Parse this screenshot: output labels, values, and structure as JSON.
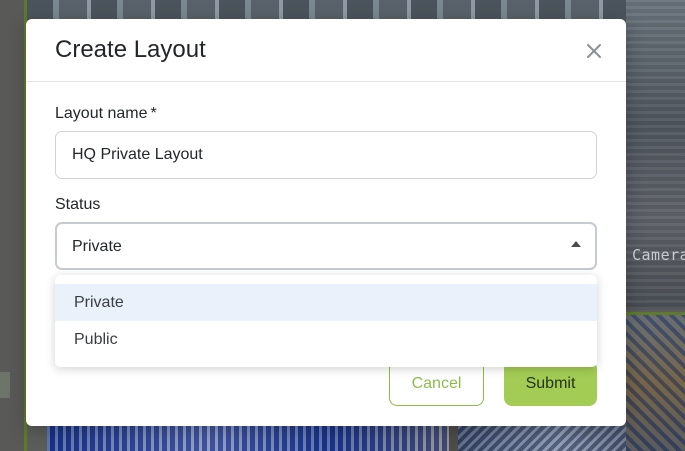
{
  "background": {
    "camera_overlay_text": "Camera"
  },
  "modal": {
    "title": "Create Layout",
    "close_icon": "close-icon",
    "layout_name": {
      "label": "Layout name",
      "required_mark": "*",
      "value": "HQ Private Layout"
    },
    "status": {
      "label": "Status",
      "selected": "Private",
      "options": [
        "Private",
        "Public"
      ],
      "highlighted_option": "Private"
    },
    "buttons": {
      "cancel": "Cancel",
      "submit": "Submit"
    }
  },
  "colors": {
    "accent": "#a3cc55",
    "accent_border": "#8dbb4a",
    "selected_option_bg": "#ebf1fa"
  }
}
